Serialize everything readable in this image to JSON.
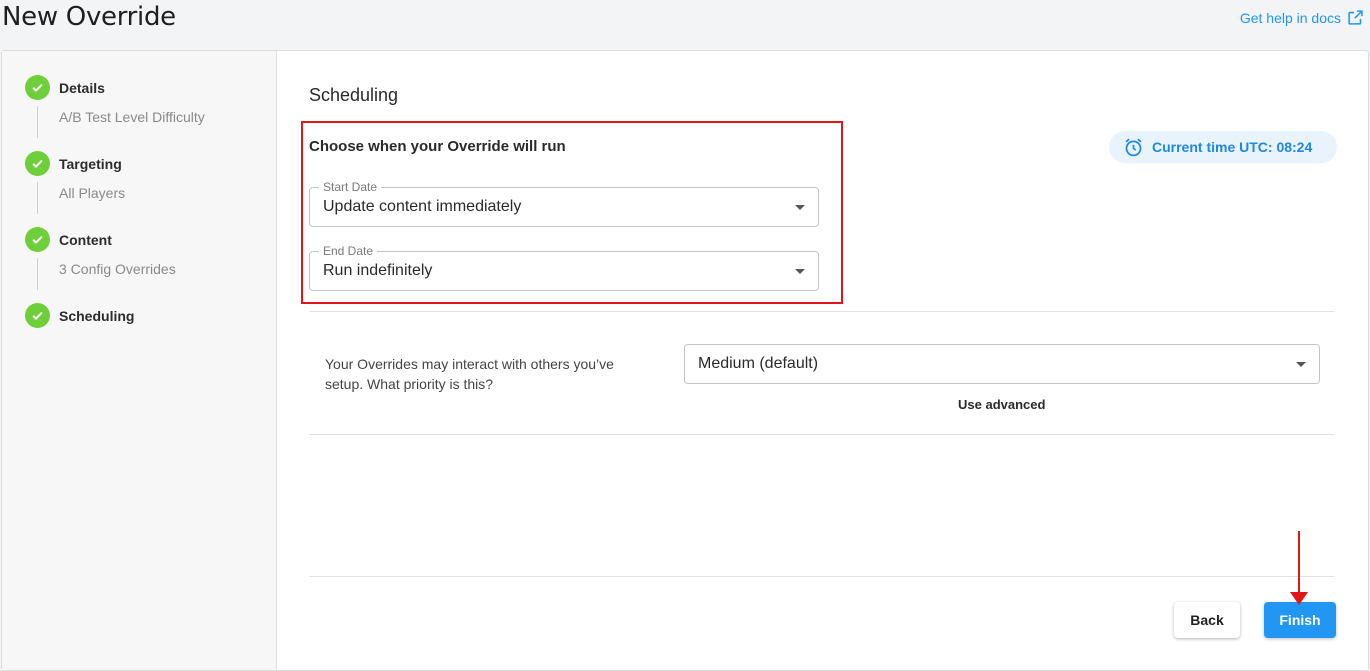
{
  "header": {
    "title": "New Override",
    "help_link": "Get help in docs",
    "help_icon": "external-link-icon"
  },
  "stepper": {
    "steps": [
      {
        "label": "Details",
        "sub": "A/B Test Level Difficulty",
        "icon": "check-icon",
        "status": "complete"
      },
      {
        "label": "Targeting",
        "sub": "All Players",
        "icon": "check-icon",
        "status": "complete"
      },
      {
        "label": "Content",
        "sub": "3 Config Overrides",
        "icon": "check-icon",
        "status": "complete"
      },
      {
        "label": "Scheduling",
        "sub": "",
        "icon": "check-icon",
        "status": "current"
      }
    ]
  },
  "main": {
    "section_title": "Scheduling",
    "choose_title": "Choose when your Override will run",
    "current_time": "Current time UTC: 08:24",
    "current_time_icon": "alarm-clock-icon",
    "start_date": {
      "label": "Start Date",
      "value": "Update content immediately"
    },
    "end_date": {
      "label": "End Date",
      "value": "Run indefinitely"
    },
    "priority": {
      "description": "Your Overrides may interact with others you’ve setup. What priority is this?",
      "value": "Medium (default)",
      "use_advanced": "Use advanced"
    }
  },
  "footer": {
    "back_label": "Back",
    "finish_label": "Finish"
  },
  "colors": {
    "accent": "#2196f3",
    "success": "#6fcf3a",
    "highlight": "#e0161a"
  }
}
